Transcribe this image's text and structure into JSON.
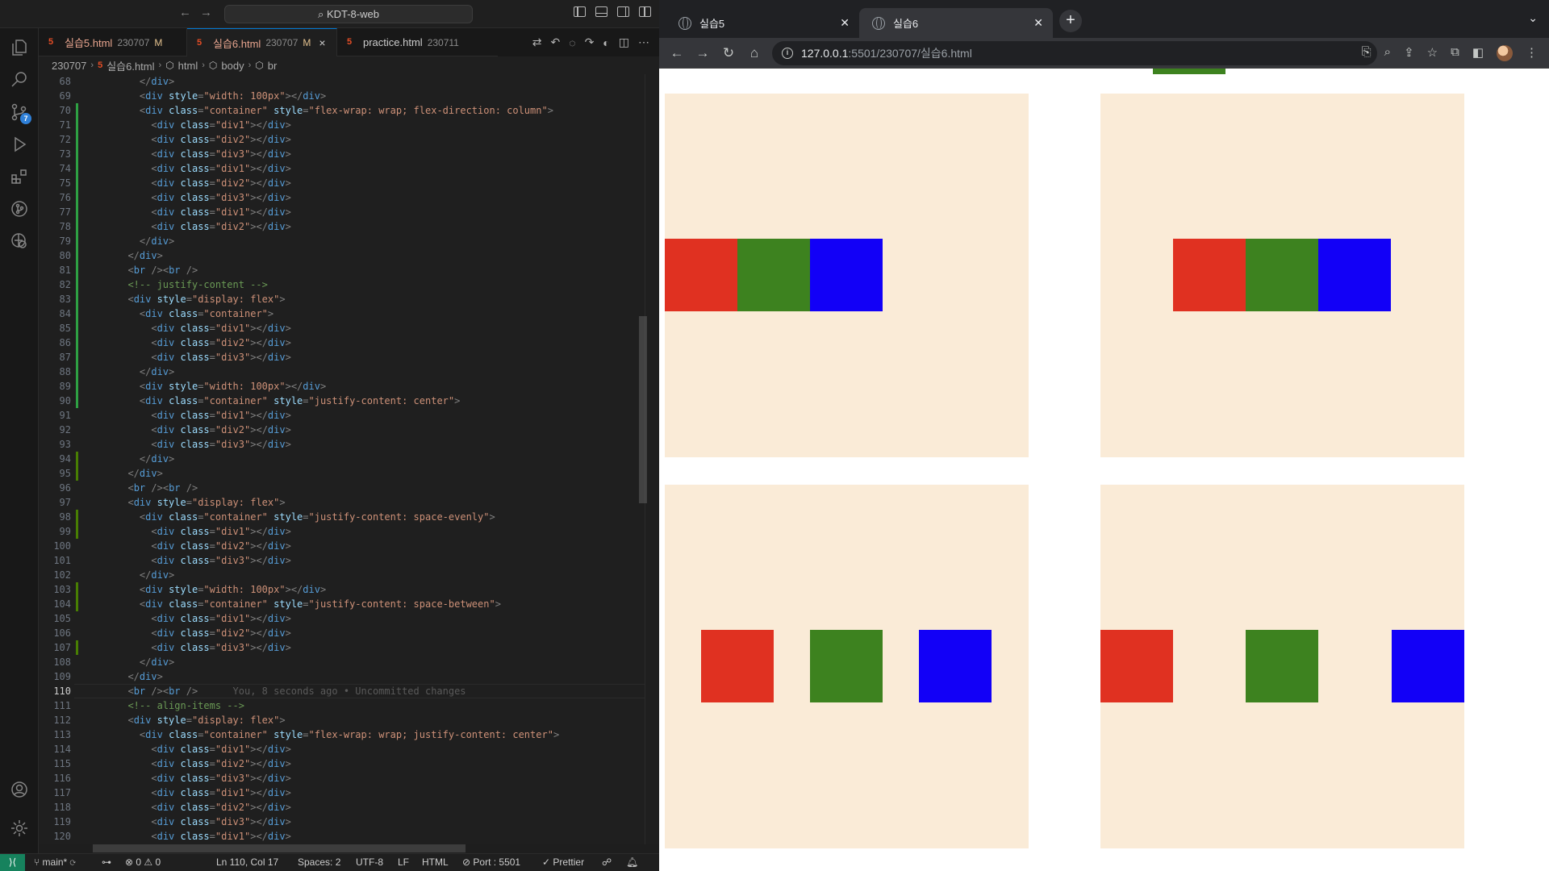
{
  "vscode": {
    "workspace": "KDT-8-web",
    "tabs": [
      {
        "name": "실습5.html",
        "dir": "230707",
        "mod": "M",
        "active": false
      },
      {
        "name": "실습6.html",
        "dir": "230707",
        "mod": "M",
        "active": true
      },
      {
        "name": "practice.html",
        "dir": "230711",
        "mod": "",
        "active": false
      }
    ],
    "breadcrumb": [
      "230707",
      "실습6.html",
      "html",
      "body",
      "br"
    ],
    "source_control_badge": "7",
    "code_lines": [
      {
        "n": "68",
        "text": "    </div>"
      },
      {
        "n": "69",
        "text": "    <div style=\"width: 100px\"></div>"
      },
      {
        "n": "70",
        "text": "    <div class=\"container\" style=\"flex-wrap: wrap; flex-direction: column\">"
      },
      {
        "n": "71",
        "text": "      <div class=\"div1\"></div>"
      },
      {
        "n": "72",
        "text": "      <div class=\"div2\"></div>"
      },
      {
        "n": "73",
        "text": "      <div class=\"div3\"></div>"
      },
      {
        "n": "74",
        "text": "      <div class=\"div1\"></div>"
      },
      {
        "n": "75",
        "text": "      <div class=\"div2\"></div>"
      },
      {
        "n": "76",
        "text": "      <div class=\"div3\"></div>"
      },
      {
        "n": "77",
        "text": "      <div class=\"div1\"></div>"
      },
      {
        "n": "78",
        "text": "      <div class=\"div2\"></div>"
      },
      {
        "n": "79",
        "text": "    </div>"
      },
      {
        "n": "80",
        "text": "  </div>"
      },
      {
        "n": "81",
        "text": "  <br /><br />"
      },
      {
        "n": "82",
        "text": "  <!-- justify-content -->"
      },
      {
        "n": "83",
        "text": "  <div style=\"display: flex\">"
      },
      {
        "n": "84",
        "text": "    <div class=\"container\">"
      },
      {
        "n": "85",
        "text": "      <div class=\"div1\"></div>"
      },
      {
        "n": "86",
        "text": "      <div class=\"div2\"></div>"
      },
      {
        "n": "87",
        "text": "      <div class=\"div3\"></div>"
      },
      {
        "n": "88",
        "text": "    </div>"
      },
      {
        "n": "89",
        "text": "    <div style=\"width: 100px\"></div>"
      },
      {
        "n": "90",
        "text": "    <div class=\"container\" style=\"justify-content: center\">"
      },
      {
        "n": "91",
        "text": "      <div class=\"div1\"></div>"
      },
      {
        "n": "92",
        "text": "      <div class=\"div2\"></div>"
      },
      {
        "n": "93",
        "text": "      <div class=\"div3\"></div>"
      },
      {
        "n": "94",
        "text": "    </div>"
      },
      {
        "n": "95",
        "text": "  </div>"
      },
      {
        "n": "96",
        "text": "  <br /><br />"
      },
      {
        "n": "97",
        "text": "  <div style=\"display: flex\">"
      },
      {
        "n": "98",
        "text": "    <div class=\"container\" style=\"justify-content: space-evenly\">"
      },
      {
        "n": "99",
        "text": "      <div class=\"div1\"></div>"
      },
      {
        "n": "100",
        "text": "      <div class=\"div2\"></div>"
      },
      {
        "n": "101",
        "text": "      <div class=\"div3\"></div>"
      },
      {
        "n": "102",
        "text": "    </div>"
      },
      {
        "n": "103",
        "text": "    <div style=\"width: 100px\"></div>"
      },
      {
        "n": "104",
        "text": "    <div class=\"container\" style=\"justify-content: space-between\">"
      },
      {
        "n": "105",
        "text": "      <div class=\"div1\"></div>"
      },
      {
        "n": "106",
        "text": "      <div class=\"div2\"></div>"
      },
      {
        "n": "107",
        "text": "      <div class=\"div3\"></div>"
      },
      {
        "n": "108",
        "text": "    </div>"
      },
      {
        "n": "109",
        "text": "  </div>"
      },
      {
        "n": "110",
        "text": "  <br /><br />",
        "blame": "You, 8 seconds ago • Uncommitted changes",
        "current": true
      },
      {
        "n": "111",
        "text": "  <!-- align-items -->"
      },
      {
        "n": "112",
        "text": "  <div style=\"display: flex\">"
      },
      {
        "n": "113",
        "text": "    <div class=\"container\" style=\"flex-wrap: wrap; justify-content: center\">"
      },
      {
        "n": "114",
        "text": "      <div class=\"div1\"></div>"
      },
      {
        "n": "115",
        "text": "      <div class=\"div2\"></div>"
      },
      {
        "n": "116",
        "text": "      <div class=\"div3\"></div>"
      },
      {
        "n": "117",
        "text": "      <div class=\"div1\"></div>"
      },
      {
        "n": "118",
        "text": "      <div class=\"div2\"></div>"
      },
      {
        "n": "119",
        "text": "      <div class=\"div3\"></div>"
      },
      {
        "n": "120",
        "text": "      <div class=\"div1\"></div>"
      }
    ],
    "status": {
      "branch": "main*",
      "errors": "0",
      "warnings": "0",
      "cursor": "Ln 110, Col 17",
      "spaces": "Spaces: 2",
      "encoding": "UTF-8",
      "eol": "LF",
      "language": "HTML",
      "port": "Port : 5501",
      "formatter": "Prettier"
    }
  },
  "browser": {
    "tabs": [
      {
        "title": "실습5",
        "active": false
      },
      {
        "title": "실습6",
        "active": true
      }
    ],
    "url_host": "127.0.0.1",
    "url_rest": ":5501/230707/실습6.html",
    "colors": {
      "div1": "#e03121",
      "div2": "#3d821f",
      "div3": "#1200f7",
      "container": "#faebd7"
    },
    "demos": [
      {
        "name": "container-default",
        "justify": "flex-start"
      },
      {
        "name": "container-center",
        "justify": "center"
      },
      {
        "name": "container-space-evenly",
        "justify": "space-evenly"
      },
      {
        "name": "container-space-between",
        "justify": "space-between"
      }
    ]
  }
}
